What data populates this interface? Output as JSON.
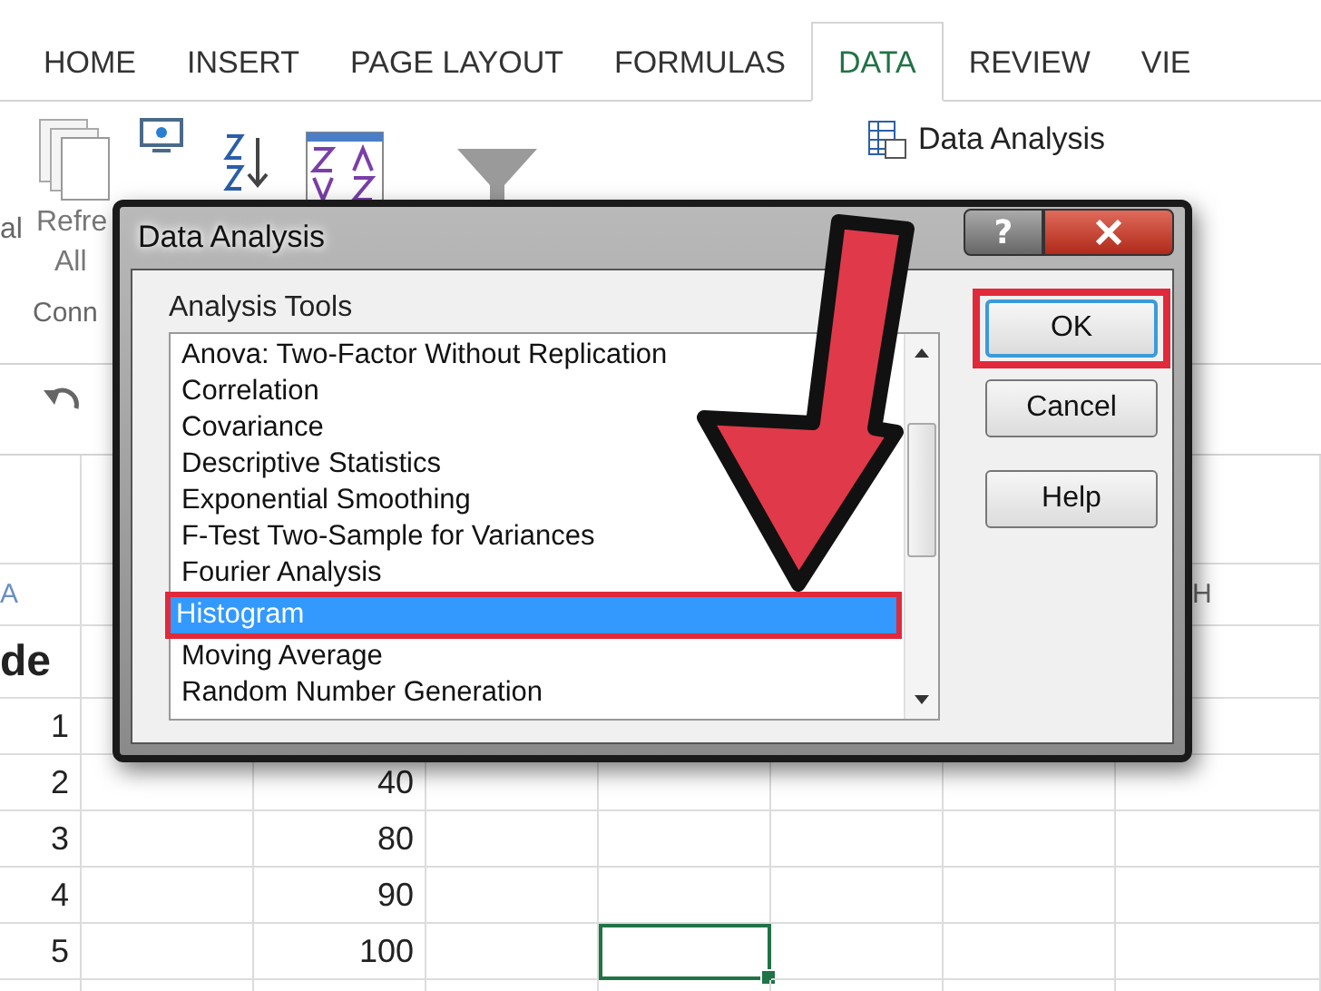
{
  "ribbon_tabs": [
    {
      "label": "HOME",
      "selected": false
    },
    {
      "label": "INSERT",
      "selected": false
    },
    {
      "label": "PAGE LAYOUT",
      "selected": false
    },
    {
      "label": "FORMULAS",
      "selected": false
    },
    {
      "label": "DATA",
      "selected": true
    },
    {
      "label": "REVIEW",
      "selected": false
    },
    {
      "label": "VIE",
      "selected": false
    }
  ],
  "ribbon": {
    "left_edge_label": "al",
    "refresh_lines": [
      "Refre",
      "All"
    ],
    "group_label": "Conn",
    "data_analysis": "Data Analysis"
  },
  "sheet": {
    "column_header": "A",
    "last_column_header": "H",
    "title_cell": "de",
    "rows": [
      {
        "number": "1",
        "value_c": null,
        "selected_e": false
      },
      {
        "number": "2",
        "value_c": "40",
        "selected_e": false
      },
      {
        "number": "3",
        "value_c": "80",
        "selected_e": false
      },
      {
        "number": "4",
        "value_c": "90",
        "selected_e": false
      },
      {
        "number": "5",
        "value_c": "100",
        "selected_e": true
      }
    ]
  },
  "dialog": {
    "title": "Data Analysis",
    "help_glyph": "?",
    "list_label": "Analysis Tools",
    "tools": [
      {
        "label": "Anova: Two-Factor Without Replication",
        "selected": false,
        "highlighted": false
      },
      {
        "label": "Correlation",
        "selected": false,
        "highlighted": false
      },
      {
        "label": "Covariance",
        "selected": false,
        "highlighted": false
      },
      {
        "label": "Descriptive Statistics",
        "selected": false,
        "highlighted": false
      },
      {
        "label": "Exponential Smoothing",
        "selected": false,
        "highlighted": false
      },
      {
        "label": "F-Test Two-Sample for Variances",
        "selected": false,
        "highlighted": false
      },
      {
        "label": "Fourier Analysis",
        "selected": false,
        "highlighted": false
      },
      {
        "label": "Histogram",
        "selected": true,
        "highlighted": true
      },
      {
        "label": "Moving Average",
        "selected": false,
        "highlighted": false
      },
      {
        "label": "Random Number Generation",
        "selected": false,
        "highlighted": false
      }
    ],
    "buttons": [
      {
        "label": "OK",
        "highlighted": true
      },
      {
        "label": "Cancel",
        "highlighted": false
      },
      {
        "label": "Help",
        "highlighted": false
      }
    ]
  }
}
